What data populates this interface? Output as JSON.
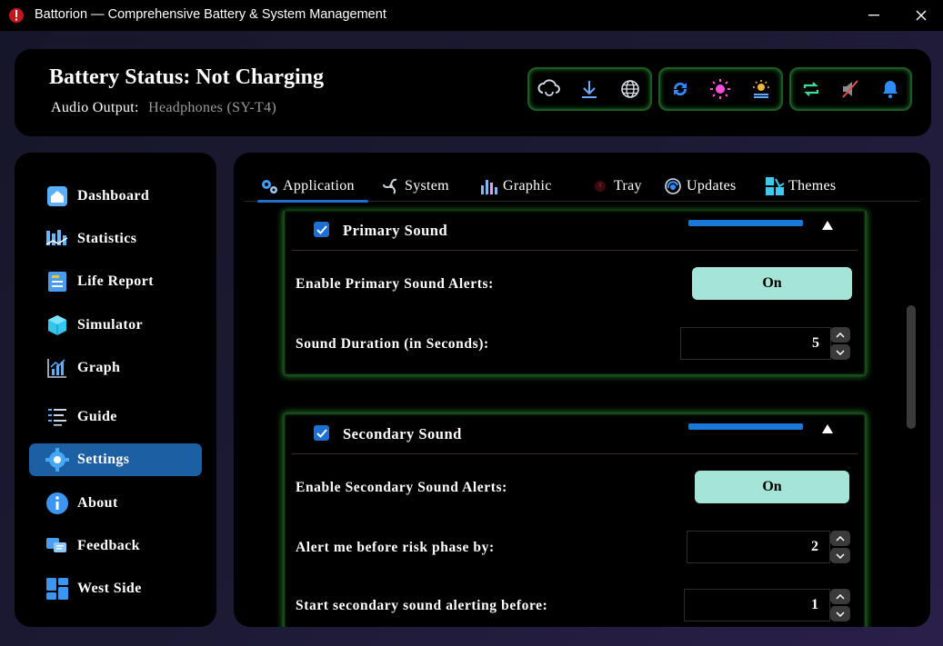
{
  "window": {
    "title": "Battorion — Comprehensive Battery & System Management",
    "minimize_glyph": "—",
    "close_glyph": "✕"
  },
  "header": {
    "status": "Battery Status: Not Charging",
    "audio_label": "Audio Output:",
    "audio_value": "Headphones (SY-T4)",
    "group1": [
      "refresh-cloud-icon",
      "download-icon",
      "globe-icon"
    ],
    "group2": [
      "sync-icon",
      "brightness-icon",
      "display-settings-icon"
    ],
    "group3": [
      "repeat-icon",
      "mute-icon",
      "bell-icon"
    ]
  },
  "sidebar": {
    "items": [
      {
        "label": "Dashboard",
        "icon": "home-icon"
      },
      {
        "label": "Statistics",
        "icon": "statistics-icon"
      },
      {
        "label": "Life Report",
        "icon": "report-icon"
      },
      {
        "label": "Simulator",
        "icon": "cube-icon"
      },
      {
        "label": "Graph",
        "icon": "graph-icon"
      },
      {
        "label": "Guide",
        "icon": "list-icon"
      },
      {
        "label": "Settings",
        "icon": "gear-icon",
        "active": true
      },
      {
        "label": "About",
        "icon": "info-icon"
      },
      {
        "label": "Feedback",
        "icon": "feedback-icon"
      },
      {
        "label": "West Side",
        "icon": "grid-icon"
      }
    ]
  },
  "tabs": [
    {
      "label": "Application",
      "icon": "gears-icon",
      "active": true
    },
    {
      "label": "System",
      "icon": "fan-icon"
    },
    {
      "label": "Graphic",
      "icon": "bar-chart-icon"
    },
    {
      "label": "Tray",
      "icon": "tray-icon"
    },
    {
      "label": "Updates",
      "icon": "update-icon"
    },
    {
      "label": "Themes",
      "icon": "themes-icon"
    }
  ],
  "primary": {
    "title": "Primary Sound",
    "checked": true,
    "enable_label": "Enable Primary Sound Alerts:",
    "enable_value": "On",
    "duration_label": "Sound Duration (in Seconds):",
    "duration_value": "5"
  },
  "secondary": {
    "title": "Secondary Sound",
    "checked": true,
    "enable_label": "Enable Secondary Sound Alerts:",
    "enable_value": "On",
    "risk_label": "Alert me before risk phase by:",
    "risk_value": "2",
    "start_label": "Start secondary sound alerting before:",
    "start_value": "1"
  },
  "colors": {
    "accent": "#1d6fd0",
    "toggle_on": "#a4e5d7",
    "glow": "#2a8a2c"
  }
}
